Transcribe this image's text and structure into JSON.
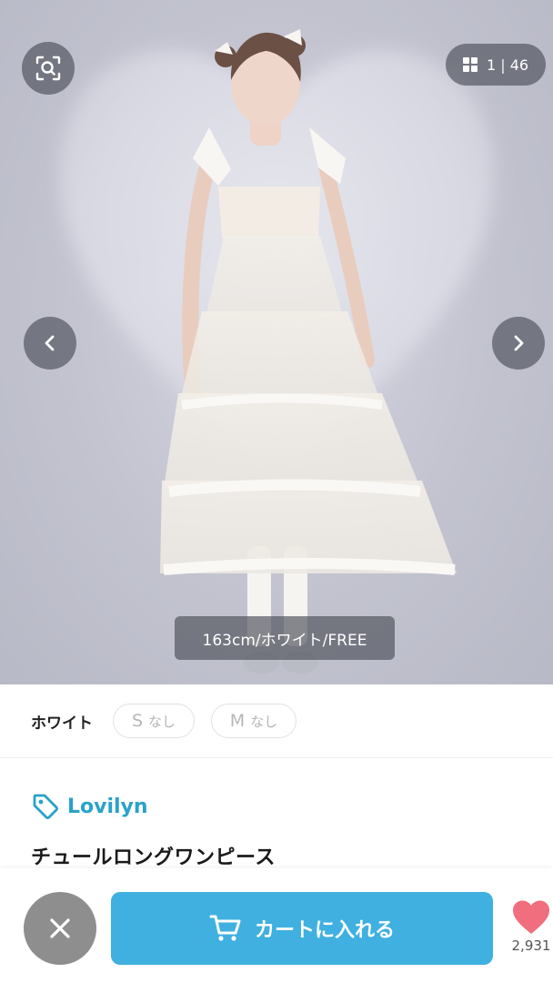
{
  "hero": {
    "counter": {
      "current": "1",
      "separator": "|",
      "total": "46"
    },
    "caption": "163cm/ホワイト/FREE",
    "icons": {
      "zoom": "image-search-icon",
      "grid": "grid-icon",
      "prev": "chevron-left-icon",
      "next": "chevron-right-icon"
    }
  },
  "variants": {
    "color_label": "ホワイト",
    "sizes": [
      {
        "size": "S",
        "status": "なし"
      },
      {
        "size": "M",
        "status": "なし"
      }
    ]
  },
  "product": {
    "brand": "Lovilyn",
    "title": "チュールロングワンピース"
  },
  "action_bar": {
    "cart_label": "カートに入れる",
    "like_count": "2,931"
  },
  "colors": {
    "accent": "#3fb0e0",
    "brand_text": "#2aa2c9",
    "heart": "#f06e7d",
    "close_bg": "#8e8e8e"
  }
}
